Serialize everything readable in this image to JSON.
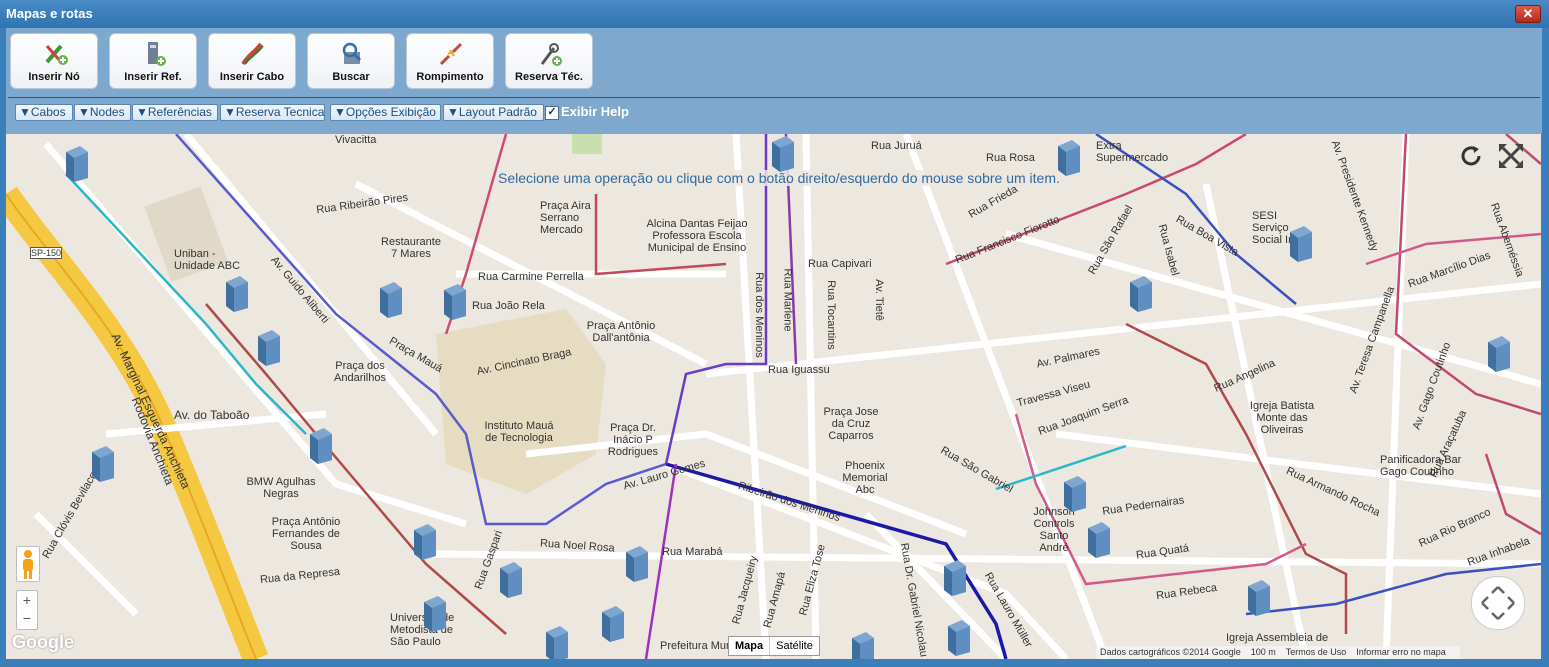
{
  "window": {
    "title": "Mapas e rotas",
    "close_label": "✕"
  },
  "toolbar": {
    "buttons": [
      {
        "label": "Inserir Nó",
        "icon": "insert-node-icon"
      },
      {
        "label": "Inserir Ref.",
        "icon": "insert-reference-icon"
      },
      {
        "label": "Inserir Cabo",
        "icon": "insert-cable-icon"
      },
      {
        "label": "Buscar",
        "icon": "search-icon"
      },
      {
        "label": "Rompimento",
        "icon": "break-icon"
      },
      {
        "label": "Reserva Téc.",
        "icon": "technical-reserve-icon"
      }
    ]
  },
  "dropdowns": [
    {
      "label": "▼Cabos"
    },
    {
      "label": "▼Nodes"
    },
    {
      "label": "▼Referências"
    },
    {
      "label": "▼Reserva Tecnica"
    },
    {
      "label": "▼Opções Exibição"
    },
    {
      "label": "▼Layout Padrão"
    }
  ],
  "help_toggle": {
    "label": "Exibir Help",
    "checked": true
  },
  "map": {
    "hint": "Selecione uma operação ou clique com o botão direito/esquerdo do mouse sobre um item.",
    "labels": [
      "Vivacitta",
      "Rua Juruá",
      "Rua Rosa",
      "Extra Supermercado",
      "Praça Aira Serrano Mercado",
      "Alcina Dantas Feijao Professora Escola Municipal de Ensino",
      "Restaurante 7 Mares",
      "Rua Carmine Perrella",
      "Rua Ribeirão Pires",
      "Uniban - Unidade ABC",
      "SP-150",
      "Av. Guido Aliberti",
      "Praça Mauá",
      "Rua João Rela",
      "Av. Cincinato Braga",
      "Praça Antônio Dall'antônia",
      "Rua Capivari",
      "Av. Tietê",
      "Rua Tocantins",
      "Rua Marlene",
      "Rua dos Meninos",
      "Rua Iguassu",
      "Praça dos Andarilhos",
      "Av. do Taboão",
      "Instituto Mauá de Tecnologia",
      "Praça Dr. Inácio P Rodrigues",
      "Praça Jose da Cruz Caparros",
      "Phoenix Memorial Abc",
      "BMW Agulhas Negras",
      "Praça Antônio Fernandes de Sousa",
      "Rua Noel Rosa",
      "Rua Marabá",
      "Rua da Represa",
      "Rua Clóvis Bevilacqua",
      "Av. Marginal Esquerda Anchieta",
      "Rodovia Anchieta",
      "Av. Lauro Gomes",
      "Ribeirão dos Meninos",
      "Rua São Gabriel",
      "Rua Joaquim Serra",
      "Travessa Viseu",
      "Av. Palmares",
      "Rua Francisco Fiorotto",
      "Rua Frieda",
      "Rua São Rafael",
      "Rua Isabel",
      "Rua Boa Vista",
      "SESI Serviço Social In",
      "Av. Presidente Kennedy",
      "Rua Abernéssia",
      "Rua Marcílio Dias",
      "Av. Teresa Campanella",
      "Av. Gago Coutinho",
      "Rua Angelina",
      "Igreja Batista Monte das Oliveiras",
      "Rua Araçatuba",
      "Panificadora Bar Gago Coutinho",
      "Rua Armando Rocha",
      "Rua Pedernairas",
      "Johnson Controls Santo André",
      "Rua Quatá",
      "Rua Rebeca",
      "Igreja Assembleia de",
      "Rua Inhabela",
      "Rua Rio Branco",
      "Universidade Metodista de São Paulo",
      "Rua Dr. Gabriel Nicolau",
      "Rua Eliza Tose",
      "Rua Amapá",
      "Rua Jacqueiry",
      "Prefeitura Municipal",
      "Rua Gaspari",
      "Rua Lauro Müller"
    ],
    "controls": {
      "map_type": [
        "Mapa",
        "Satélite"
      ],
      "zoom_in": "+",
      "zoom_out": "−",
      "google_logo": "Google",
      "footer": [
        "Dados cartográficos ©2014 Google",
        "100 m",
        "Termos de Uso",
        "Informar erro no mapa"
      ]
    }
  }
}
